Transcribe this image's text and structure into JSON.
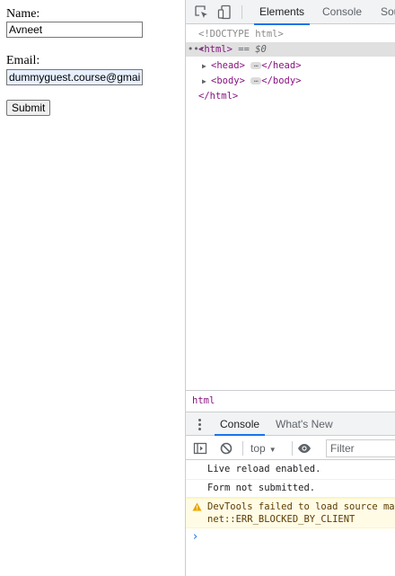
{
  "form": {
    "name_label": "Name:",
    "name_value": "Avneet",
    "email_label": "Email:",
    "email_value": "dummyguest.course@gmail.com",
    "submit_label": "Submit"
  },
  "devtools": {
    "tabs": [
      "Elements",
      "Console",
      "Sources"
    ],
    "active_tab": "Elements",
    "elements": {
      "doctype": "<!DOCTYPE html>",
      "html_open": "<html>",
      "selected_marker": "== $0",
      "head_open": "<head>",
      "head_close": "</head>",
      "body_open": "<body>",
      "body_close": "</body>",
      "html_close": "</html>"
    },
    "breadcrumb": "html",
    "drawer_tabs": [
      "Console",
      "What's New"
    ],
    "console_toolbar": {
      "context": "top",
      "filter_placeholder": "Filter"
    },
    "console_messages": [
      {
        "level": "log",
        "text": "Live reload enabled."
      },
      {
        "level": "log",
        "text": "Form not submitted."
      },
      {
        "level": "warning",
        "text": "DevTools failed to load source map",
        "text2": "net::ERR_BLOCKED_BY_CLIENT"
      }
    ],
    "prompt_symbol": "›"
  },
  "colors": {
    "accent": "#1a73e8",
    "tag": "#881280",
    "warning_bg": "#fffbe5"
  }
}
